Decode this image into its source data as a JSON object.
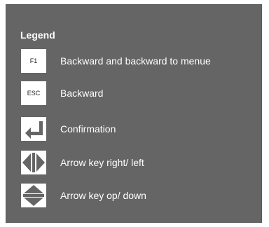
{
  "legend": {
    "title": "Legend",
    "items": [
      {
        "key_text": "F1",
        "icon": "f1-key-icon",
        "label": "Backward and backward to menue"
      },
      {
        "key_text": "ESC",
        "icon": "esc-key-icon",
        "label": "Backward"
      },
      {
        "key_text": "",
        "icon": "enter-key-icon",
        "label": "Confirmation"
      },
      {
        "key_text": "",
        "icon": "arrow-left-right-icon",
        "label": "Arrow key right/ left"
      },
      {
        "key_text": "",
        "icon": "arrow-up-down-icon",
        "label": "Arrow key op/ down"
      }
    ]
  },
  "colors": {
    "panel_background": "#656565",
    "text": "#ffffff",
    "key_background": "#ffffff"
  }
}
